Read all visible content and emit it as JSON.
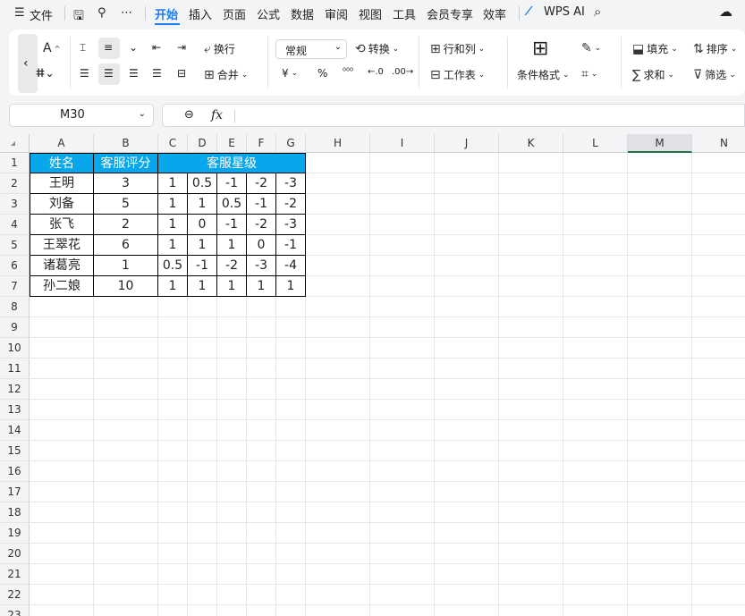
{
  "menubar": {
    "menu_label": "文件",
    "tabs": [
      "开始",
      "插入",
      "页面",
      "公式",
      "数据",
      "审阅",
      "视图",
      "工具",
      "会员专享",
      "效率"
    ],
    "wps_ai": "WPS AI"
  },
  "ribbon": {
    "wrap_label": "换行",
    "merge_label": "合并",
    "number_format": "常规",
    "convert_label": "转换",
    "row_col_label": "行和列",
    "worksheet_label": "工作表",
    "cond_format_label": "条件格式",
    "fill_label": "填充",
    "sort_label": "排序",
    "sum_label": "求和",
    "filter_label": "筛选"
  },
  "formula_bar": {
    "name_box": "M30",
    "fx_label": "fx",
    "content": ""
  },
  "sheet": {
    "columns": [
      "A",
      "B",
      "C",
      "D",
      "E",
      "F",
      "G",
      "H",
      "I",
      "J",
      "K",
      "L",
      "M",
      "N"
    ],
    "selected_column": "M",
    "rows": [
      "1",
      "2",
      "3",
      "4",
      "5",
      "6",
      "7",
      "8",
      "9",
      "10",
      "11",
      "12",
      "13",
      "14",
      "15",
      "16",
      "17",
      "18",
      "19",
      "20",
      "21",
      "22",
      "23"
    ],
    "header": {
      "name": "姓名",
      "score": "客服评分",
      "stars": "客服星级"
    },
    "data": [
      {
        "name": "王明",
        "score": "3",
        "c": "1",
        "d": "0.5",
        "e": "-1",
        "f": "-2",
        "g": "-3"
      },
      {
        "name": "刘备",
        "score": "5",
        "c": "1",
        "d": "1",
        "e": "0.5",
        "f": "-1",
        "g": "-2"
      },
      {
        "name": "张飞",
        "score": "2",
        "c": "1",
        "d": "0",
        "e": "-1",
        "f": "-2",
        "g": "-3"
      },
      {
        "name": "王翠花",
        "score": "6",
        "c": "1",
        "d": "1",
        "e": "1",
        "f": "0",
        "g": "-1"
      },
      {
        "name": "诸葛亮",
        "score": "1",
        "c": "0.5",
        "d": "-1",
        "e": "-2",
        "f": "-3",
        "g": "-4"
      },
      {
        "name": "孙二娘",
        "score": "10",
        "c": "1",
        "d": "1",
        "e": "1",
        "f": "1",
        "g": "1"
      }
    ],
    "header_color": "#08a6ea",
    "accent_color": "#1a7cf2"
  }
}
